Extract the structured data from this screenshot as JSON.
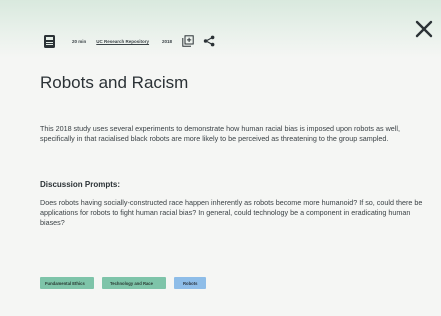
{
  "meta": {
    "duration": "20 min",
    "source": "UC Research Repository",
    "year": "2018"
  },
  "icons": {
    "resource_type": "document-icon",
    "add": "add-to-collection-icon",
    "share": "share-icon",
    "close": "close-icon"
  },
  "article": {
    "title": "Robots and Racism",
    "description": "This 2018 study uses several experiments to demonstrate how human racial bias is imposed upon robots as well, specifically in that racialised black robots are more likely to be perceived as threatening to the group sampled.",
    "prompts_heading": "Discussion Prompts:",
    "prompts_text": "Does robots having socially-constructed race happen inherently as robots become more humanoid? If so, could there be applications for robots to fight human racial bias? In general, could technology be a component in eradicating human biases?"
  },
  "tags": [
    {
      "label": "Fundamental Ethics",
      "color": "#7ec4a9"
    },
    {
      "label": "Technology and Race",
      "color": "#7ec4a9"
    },
    {
      "label": "Robots",
      "color": "#8ebde8"
    }
  ],
  "colors": {
    "header_band": "#d9e9de",
    "text": "#2b3236",
    "background": "#f5f6f4"
  }
}
